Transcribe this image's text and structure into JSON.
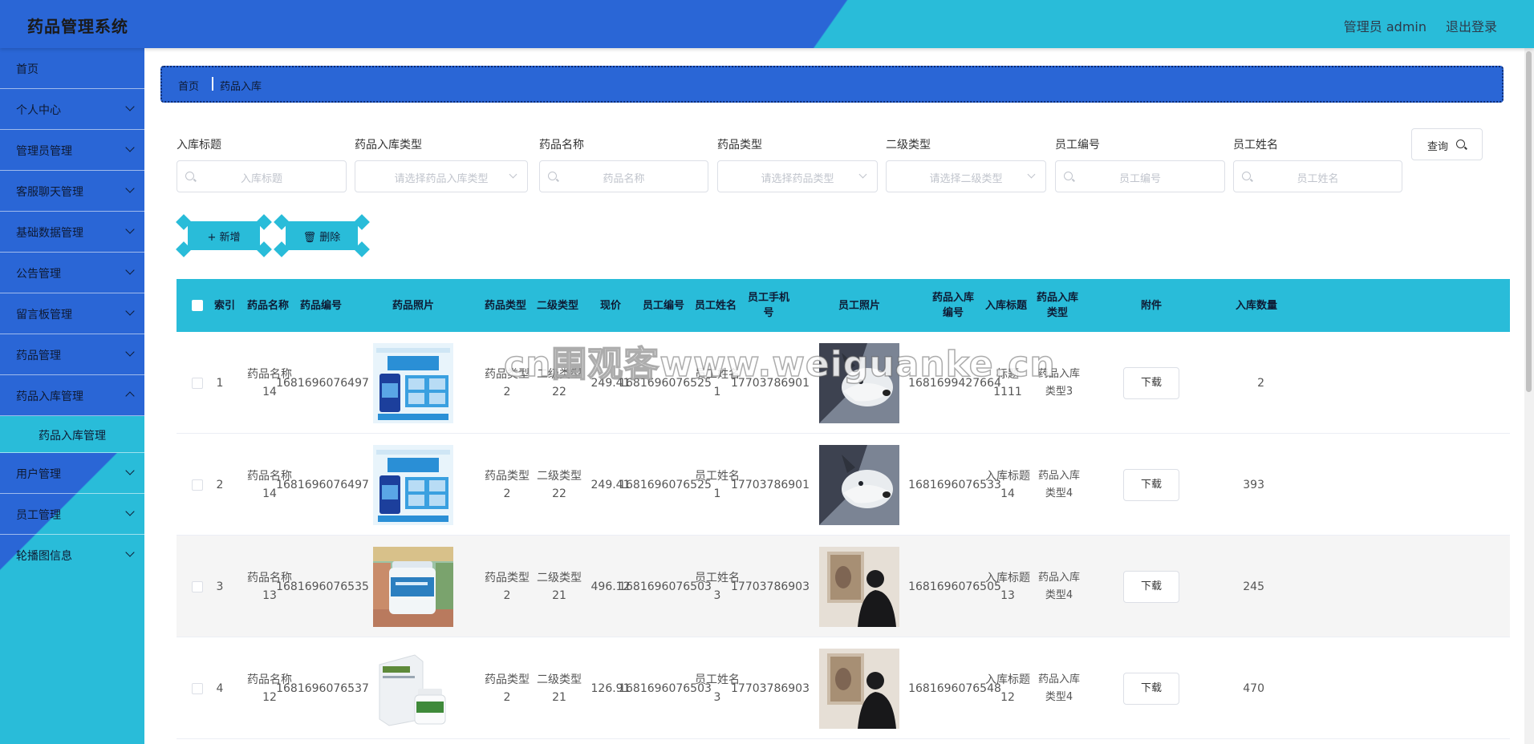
{
  "header": {
    "title": "药品管理系统",
    "user": "管理员 admin",
    "logout": "退出登录"
  },
  "sidebar": {
    "items": [
      {
        "label": "首页"
      },
      {
        "label": "个人中心"
      },
      {
        "label": "管理员管理"
      },
      {
        "label": "客服聊天管理"
      },
      {
        "label": "基础数据管理"
      },
      {
        "label": "公告管理"
      },
      {
        "label": "留言板管理"
      },
      {
        "label": "药品管理"
      },
      {
        "label": "药品入库管理"
      },
      {
        "label": "用户管理"
      },
      {
        "label": "员工管理"
      },
      {
        "label": "轮播图信息"
      }
    ],
    "submenu": {
      "label": "药品入库管理"
    }
  },
  "breadcrumb": {
    "home": "首页",
    "current": "药品入库"
  },
  "search": {
    "fields": [
      {
        "label": "入库标题",
        "placeholder": "入库标题"
      },
      {
        "label": "药品入库类型",
        "placeholder": "请选择药品入库类型"
      },
      {
        "label": "药品名称",
        "placeholder": "药品名称"
      },
      {
        "label": "药品类型",
        "placeholder": "请选择药品类型"
      },
      {
        "label": "二级类型",
        "placeholder": "请选择二级类型"
      },
      {
        "label": "员工编号",
        "placeholder": "员工编号"
      },
      {
        "label": "员工姓名",
        "placeholder": "员工姓名"
      }
    ],
    "query_label": "查询"
  },
  "actions": {
    "add": "+ 新增",
    "delete": "🗑 删除"
  },
  "table": {
    "headers": [
      "索引",
      "药品名称",
      "药品编号",
      "药品照片",
      "药品类型",
      "二级类型",
      "现价",
      "员工编号",
      "员工姓名",
      "员工手机号",
      "员工照片",
      "药品入库编号",
      "入库标题",
      "药品入库类型",
      "附件",
      "入库数量"
    ],
    "rows": [
      {
        "index": "1",
        "name": "药品名称14",
        "code": "1681696076497",
        "type": "药品类型2",
        "sub": "二级类型22",
        "price": "249.41",
        "emp_no": "1681696076525",
        "emp_name": "员工姓名1",
        "phone": "17703786901",
        "in_no": "1681699427664",
        "title": "标题1111",
        "in_type": "药品入库类型3",
        "download": "下载",
        "qty": "2",
        "drug_img": "blue-box",
        "emp_img": "husky"
      },
      {
        "index": "2",
        "name": "药品名称14",
        "code": "1681696076497",
        "type": "药品类型2",
        "sub": "二级类型22",
        "price": "249.41",
        "emp_no": "1681696076525",
        "emp_name": "员工姓名1",
        "phone": "17703786901",
        "in_no": "1681696076533",
        "title": "入库标题14",
        "in_type": "药品入库类型4",
        "download": "下载",
        "qty": "393",
        "drug_img": "blue-box",
        "emp_img": "husky"
      },
      {
        "index": "3",
        "name": "药品名称13",
        "code": "1681696076535",
        "type": "药品类型2",
        "sub": "二级类型21",
        "price": "496.12",
        "emp_no": "1681696076503",
        "emp_name": "员工姓名3",
        "phone": "17703786903",
        "in_no": "1681696076505",
        "title": "入库标题13",
        "in_type": "药品入库类型4",
        "download": "下载",
        "qty": "245",
        "drug_img": "bottle",
        "emp_img": "person"
      },
      {
        "index": "4",
        "name": "药品名称12",
        "code": "1681696076537",
        "type": "药品类型2",
        "sub": "二级类型21",
        "price": "126.91",
        "emp_no": "1681696076503",
        "emp_name": "员工姓名3",
        "phone": "17703786903",
        "in_no": "1681696076548",
        "title": "入库标题12",
        "in_type": "药品入库类型4",
        "download": "下载",
        "qty": "470",
        "drug_img": "white-box",
        "emp_img": "person"
      }
    ]
  },
  "watermark": "cn围观客www.weiguanke.cn"
}
